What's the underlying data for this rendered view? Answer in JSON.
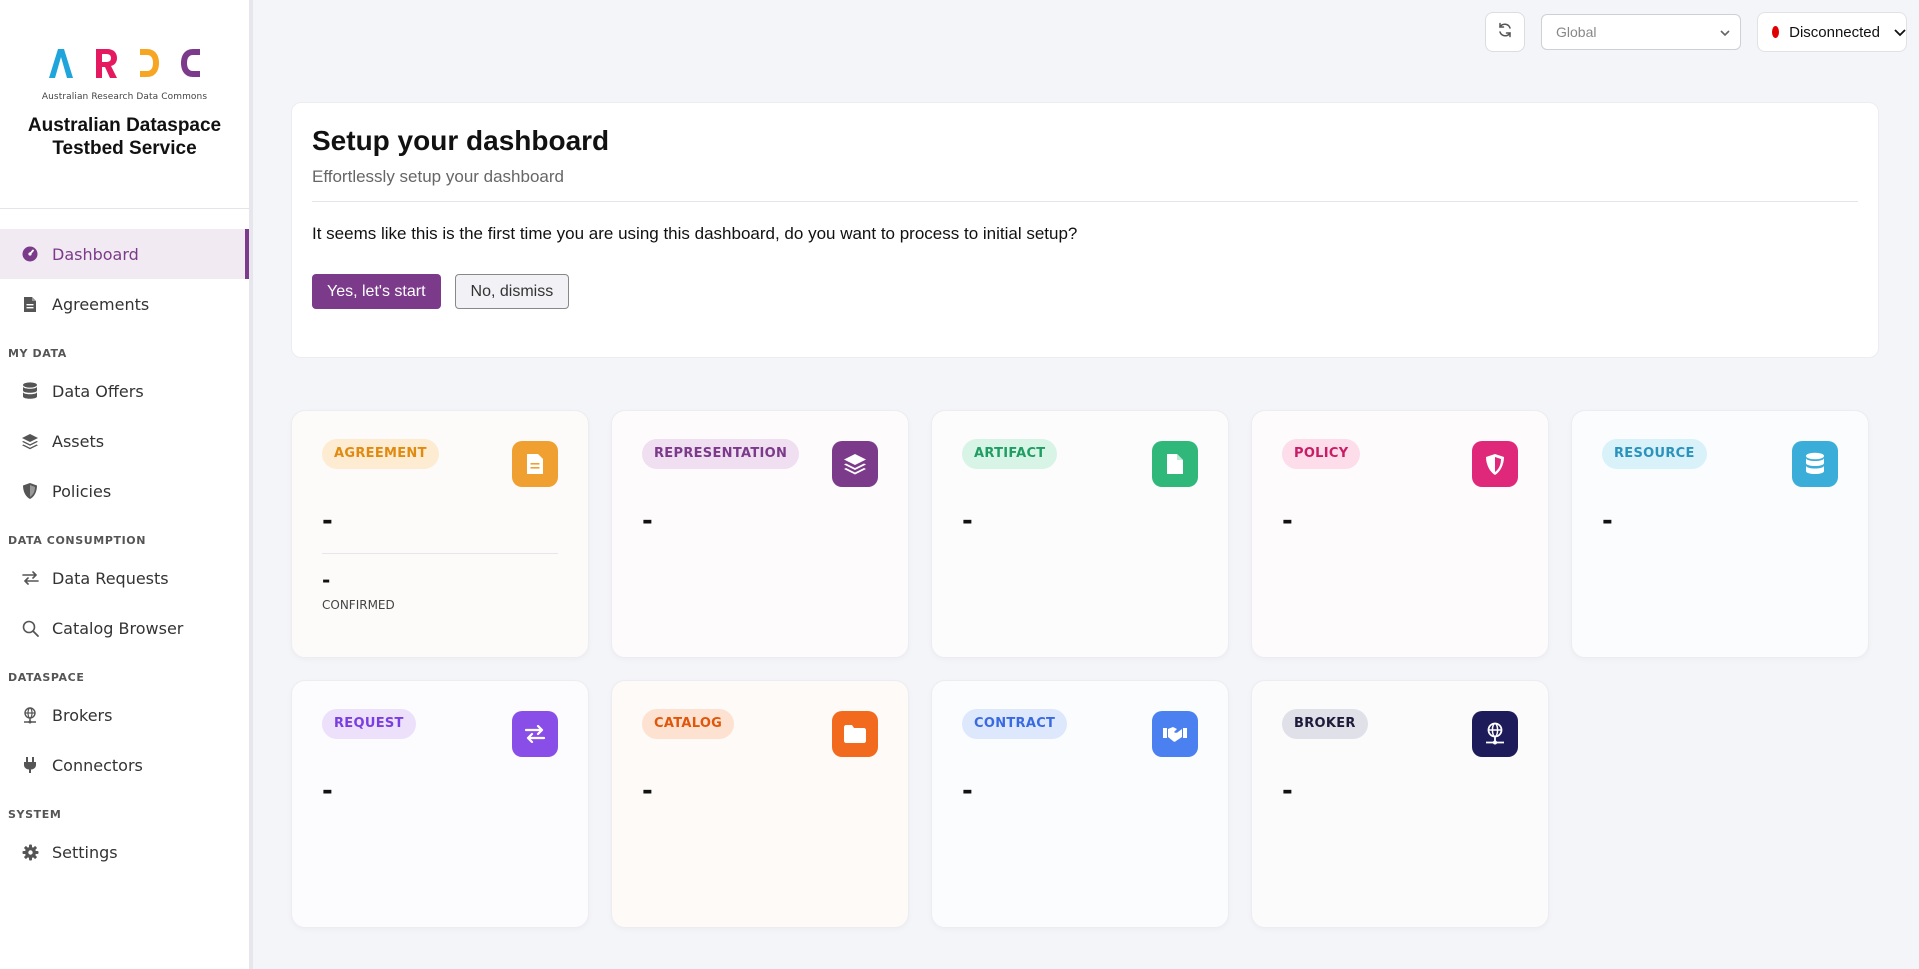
{
  "brand": {
    "subtitle": "Australian Research Data Commons",
    "title_line1": "Australian Dataspace",
    "title_line2": "Testbed Service"
  },
  "nav": {
    "dashboard": "Dashboard",
    "agreements": "Agreements",
    "section_my_data": "MY DATA",
    "data_offers": "Data Offers",
    "assets": "Assets",
    "policies": "Policies",
    "section_data_consumption": "DATA CONSUMPTION",
    "data_requests": "Data Requests",
    "catalog_browser": "Catalog Browser",
    "section_dataspace": "DATASPACE",
    "brokers": "Brokers",
    "connectors": "Connectors",
    "section_system": "SYSTEM",
    "settings": "Settings"
  },
  "topbar": {
    "scope_value": "Global",
    "status_label": "Disconnected",
    "status_color": "#e00000"
  },
  "setup": {
    "title": "Setup your dashboard",
    "subtitle": "Effortlessly setup your dashboard",
    "question": "It seems like this is the first time you are using this dashboard, do you want to process to initial setup?",
    "yes_label": "Yes, let's start",
    "no_label": "No, dismiss"
  },
  "cards": {
    "agreement": {
      "label": "AGREEMENT",
      "value": "-",
      "subvalue": "-",
      "sublabel": "CONFIRMED",
      "icon": "document-icon",
      "color": "#f0a030"
    },
    "representation": {
      "label": "REPRESENTATION",
      "value": "-",
      "icon": "layers-icon",
      "color": "#7b3a8a"
    },
    "artifact": {
      "label": "ARTIFACT",
      "value": "-",
      "icon": "file-icon",
      "color": "#2fb87a"
    },
    "policy": {
      "label": "POLICY",
      "value": "-",
      "icon": "shield-icon",
      "color": "#e0287a"
    },
    "resource": {
      "label": "RESOURCE",
      "value": "-",
      "icon": "database-icon",
      "color": "#3aaed8"
    },
    "request": {
      "label": "REQUEST",
      "value": "-",
      "icon": "arrows-exchange-icon",
      "color": "#8a4ee8"
    },
    "catalog": {
      "label": "CATALOG",
      "value": "-",
      "icon": "folder-icon",
      "color": "#f26a1e"
    },
    "contract": {
      "label": "CONTRACT",
      "value": "-",
      "icon": "handshake-icon",
      "color": "#4a80f0"
    },
    "broker": {
      "label": "BROKER",
      "value": "-",
      "icon": "network-globe-icon",
      "color": "#1e1b5a"
    }
  }
}
